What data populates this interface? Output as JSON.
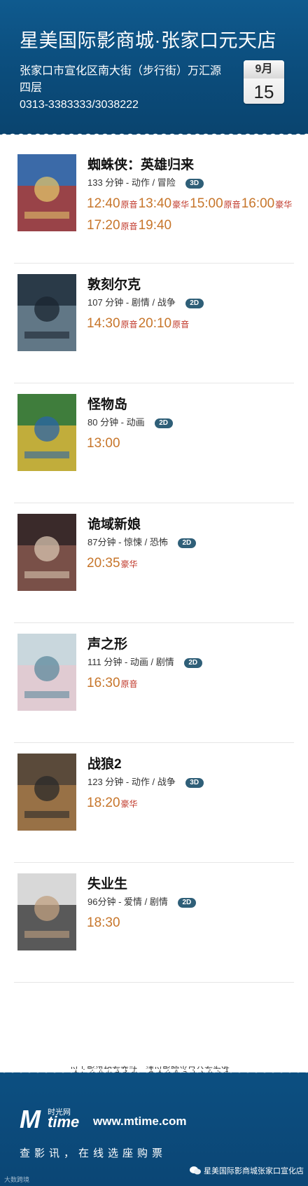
{
  "header": {
    "title": "星美国际影商城·张家口元天店",
    "address": "张家口市宣化区南大街（步行街）万汇源四层",
    "phone": "0313-3383333/3038222",
    "date_month": "9月",
    "date_day": "15"
  },
  "movies": [
    {
      "title": "蜘蛛侠：英雄归来",
      "info": "133 分钟 - 动作 / 冒险",
      "format": "3D",
      "showtimes": [
        {
          "time": "12:40",
          "hall": "原音"
        },
        {
          "time": "13:40",
          "hall": "豪华"
        },
        {
          "time": "15:00",
          "hall": "原音"
        },
        {
          "time": "16:00",
          "hall": "豪华"
        },
        {
          "time": "17:20",
          "hall": "原音"
        },
        {
          "time": "19:40",
          "hall": ""
        }
      ]
    },
    {
      "title": "敦刻尔克",
      "info": "107 分钟 - 剧情 / 战争",
      "format": "2D",
      "showtimes": [
        {
          "time": "14:30",
          "hall": "原音"
        },
        {
          "time": "20:10",
          "hall": "原音"
        }
      ]
    },
    {
      "title": "怪物岛",
      "info": "80 分钟 - 动画",
      "format": "2D",
      "showtimes": [
        {
          "time": "13:00",
          "hall": ""
        }
      ]
    },
    {
      "title": "诡域新娘",
      "info": "87分钟 - 惊悚 / 恐怖",
      "format": "2D",
      "showtimes": [
        {
          "time": "20:35",
          "hall": "豪华"
        }
      ]
    },
    {
      "title": "声之形",
      "info": "111 分钟 - 动画 / 剧情",
      "format": "2D",
      "showtimes": [
        {
          "time": "16:30",
          "hall": "原音"
        }
      ]
    },
    {
      "title": "战狼2",
      "info": "123 分钟 - 动作 / 战争",
      "format": "3D",
      "showtimes": [
        {
          "time": "18:20",
          "hall": "豪华"
        }
      ]
    },
    {
      "title": "失业生",
      "info": "96分钟 - 爱情 / 剧情",
      "format": "2D",
      "showtimes": [
        {
          "time": "18:30",
          "hall": ""
        }
      ]
    }
  ],
  "footer_note": "以上影讯如有变动，请以影院当日公布为准。",
  "footer": {
    "logo_small": "时光网",
    "logo_text": "time",
    "website": "www.mtime.com",
    "slogan": "查影讯，在线选座购票",
    "wechat_account": "星美国际影商城张家口宣化店",
    "watermark": "大数跨境"
  },
  "colors": {
    "header_blue": "#0b4c7b",
    "showtime": "#c7762b",
    "hall_label": "#c0392b",
    "format_badge": "#2f5f78"
  }
}
